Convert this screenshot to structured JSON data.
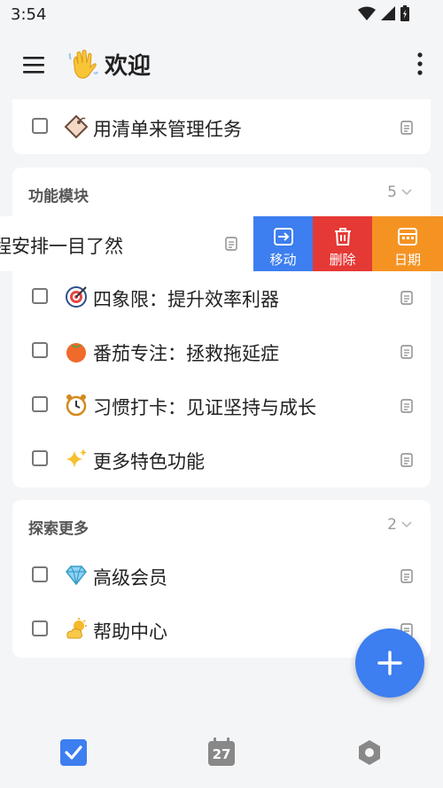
{
  "status_bar": {
    "time": "3:54"
  },
  "app_bar": {
    "emoji": "waving-hand",
    "title": "欢迎"
  },
  "colors": {
    "accent": "#3d7ef0",
    "move_action": "#3d7ef0",
    "delete_action": "#e53935",
    "date_action": "#f59322"
  },
  "top_card": {
    "items": [
      {
        "icon": "tag",
        "label": "用清单来管理任务"
      }
    ]
  },
  "features_section": {
    "title": "功能模块",
    "count": "5",
    "swiped_item": {
      "label": "程安排一目了然"
    },
    "swipe_actions": [
      {
        "icon": "move",
        "label": "移动"
      },
      {
        "icon": "trash",
        "label": "删除"
      },
      {
        "icon": "calendar",
        "label": "日期"
      }
    ],
    "items": [
      {
        "icon": "target",
        "label": "四象限：提升效率利器"
      },
      {
        "icon": "tomato",
        "label": "番茄专注：拯救拖延症"
      },
      {
        "icon": "alarm-clock",
        "label": "习惯打卡：见证坚持与成长"
      },
      {
        "icon": "sparkles",
        "label": "更多特色功能"
      }
    ]
  },
  "explore_section": {
    "title": "探索更多",
    "count": "2",
    "items": [
      {
        "icon": "diamond",
        "label": "高级会员"
      },
      {
        "icon": "sun-cloud",
        "label": "帮助中心"
      }
    ]
  },
  "bottom_nav": {
    "calendar_day": "27"
  }
}
